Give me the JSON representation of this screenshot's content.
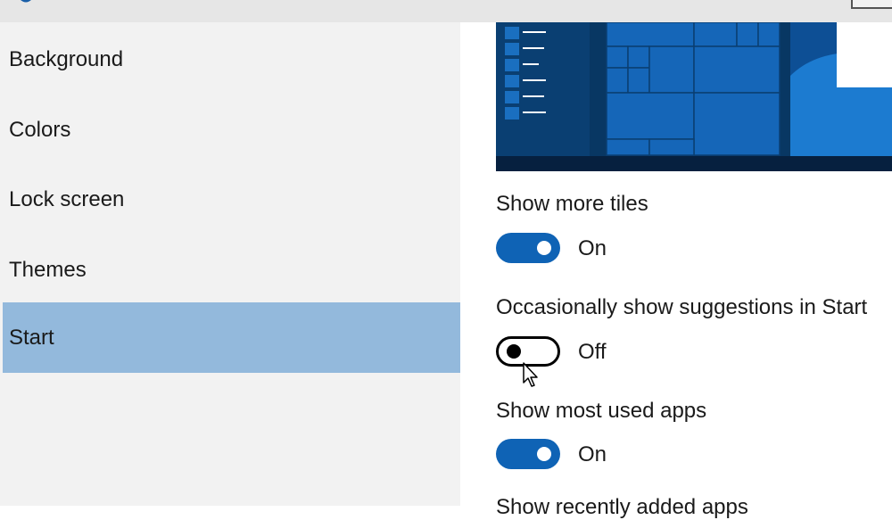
{
  "sidebar": {
    "items": [
      {
        "label": "Background"
      },
      {
        "label": "Colors"
      },
      {
        "label": "Lock screen"
      },
      {
        "label": "Themes"
      },
      {
        "label": "Start",
        "selected": true
      }
    ]
  },
  "settings": [
    {
      "label": "Show more tiles",
      "state": "On",
      "on": true
    },
    {
      "label": "Occasionally show suggestions in Start",
      "state": "Off",
      "on": false
    },
    {
      "label": "Show most used apps",
      "state": "On",
      "on": true
    },
    {
      "label": "Show recently added apps"
    }
  ],
  "colors": {
    "accent": "#0f63b5",
    "selected_nav": "#93b9dc",
    "sidebar_bg": "#f2f2f2"
  }
}
